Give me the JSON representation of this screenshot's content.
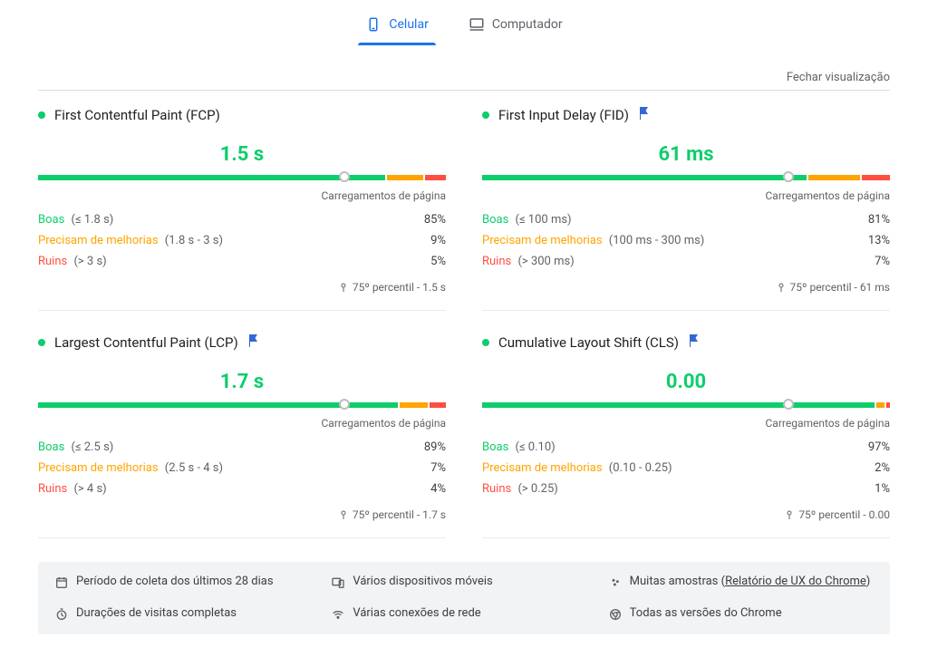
{
  "tabs": {
    "mobile": "Celular",
    "desktop": "Computador"
  },
  "close_label": "Fechar visualização",
  "metrics": [
    {
      "key": "fcp",
      "title": "First Contentful Paint (FCP)",
      "has_flag": false,
      "value": "1.5 s",
      "bar": {
        "good": 85,
        "improve": 9,
        "poor": 5,
        "marker": 75
      },
      "sub": "Carregamentos de página",
      "rows": [
        {
          "cls": "g",
          "label": "Boas",
          "range": "(≤ 1.8 s)",
          "pct": "85%"
        },
        {
          "cls": "o",
          "label": "Precisam de melhorias",
          "range": "(1.8 s - 3 s)",
          "pct": "9%"
        },
        {
          "cls": "r",
          "label": "Ruins",
          "range": "(> 3 s)",
          "pct": "5%"
        }
      ],
      "percentile": "75º percentil - 1.5 s"
    },
    {
      "key": "fid",
      "title": "First Input Delay (FID)",
      "has_flag": true,
      "value": "61 ms",
      "bar": {
        "good": 81,
        "improve": 13,
        "poor": 7,
        "marker": 75
      },
      "sub": "Carregamentos de página",
      "rows": [
        {
          "cls": "g",
          "label": "Boas",
          "range": "(≤ 100 ms)",
          "pct": "81%"
        },
        {
          "cls": "o",
          "label": "Precisam de melhorias",
          "range": "(100 ms - 300 ms)",
          "pct": "13%"
        },
        {
          "cls": "r",
          "label": "Ruins",
          "range": "(> 300 ms)",
          "pct": "7%"
        }
      ],
      "percentile": "75º percentil - 61 ms"
    },
    {
      "key": "lcp",
      "title": "Largest Contentful Paint (LCP)",
      "has_flag": true,
      "value": "1.7 s",
      "bar": {
        "good": 89,
        "improve": 7,
        "poor": 4,
        "marker": 75
      },
      "sub": "Carregamentos de página",
      "rows": [
        {
          "cls": "g",
          "label": "Boas",
          "range": "(≤ 2.5 s)",
          "pct": "89%"
        },
        {
          "cls": "o",
          "label": "Precisam de melhorias",
          "range": "(2.5 s - 4 s)",
          "pct": "7%"
        },
        {
          "cls": "r",
          "label": "Ruins",
          "range": "(> 4 s)",
          "pct": "4%"
        }
      ],
      "percentile": "75º percentil - 1.7 s"
    },
    {
      "key": "cls",
      "title": "Cumulative Layout Shift (CLS)",
      "has_flag": true,
      "value": "0.00",
      "bar": {
        "good": 97,
        "improve": 2,
        "poor": 1,
        "marker": 75
      },
      "sub": "Carregamentos de página",
      "rows": [
        {
          "cls": "g",
          "label": "Boas",
          "range": "(≤ 0.10)",
          "pct": "97%"
        },
        {
          "cls": "o",
          "label": "Precisam de melhorias",
          "range": "(0.10 - 0.25)",
          "pct": "2%"
        },
        {
          "cls": "r",
          "label": "Ruins",
          "range": "(> 0.25)",
          "pct": "1%"
        }
      ],
      "percentile": "75º percentil - 0.00"
    }
  ],
  "footer": {
    "period": "Período de coleta dos últimos 28 dias",
    "devices": "Vários dispositivos móveis",
    "samples_pre": "Muitas amostras",
    "samples_link_pre": " (",
    "samples_link": "Relatório de UX do Chrome",
    "samples_link_post": ")",
    "visits": "Durações de visitas completas",
    "network": "Várias conexões de rede",
    "versions": "Todas as versões do Chrome"
  }
}
